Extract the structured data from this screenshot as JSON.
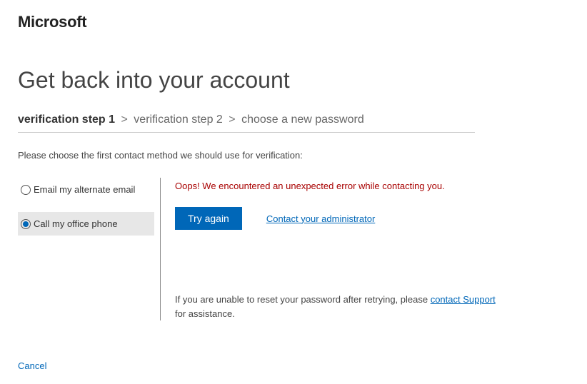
{
  "header": {
    "logo": "Microsoft"
  },
  "title": "Get back into your account",
  "breadcrumbs": {
    "step1": "verification step 1",
    "sep": ">",
    "step2": "verification step 2",
    "step3": "choose a new password"
  },
  "instructions": "Please choose the first contact method we should use for verification:",
  "methods": {
    "email": "Email my alternate email",
    "call": "Call my office phone"
  },
  "error": "Oops! We encountered an unexpected error while contacting you.",
  "actions": {
    "try_again": "Try again",
    "contact_admin": "Contact your administrator"
  },
  "support": {
    "text_before": "If you are unable to reset your password after retrying, please ",
    "link": "contact Support",
    "text_after": " for assistance."
  },
  "cancel": "Cancel"
}
